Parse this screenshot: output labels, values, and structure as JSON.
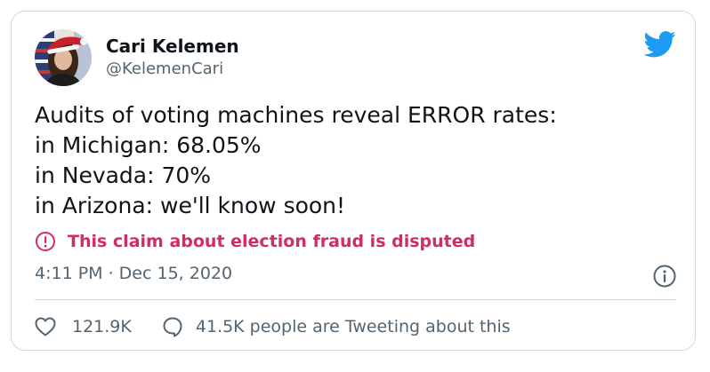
{
  "tweet": {
    "author_name": "Cari Kelemen",
    "author_handle": "@KelemenCari",
    "text_lines": [
      "Audits of voting machines reveal ERROR rates:",
      "in Michigan: 68.05%",
      "in Nevada: 70%",
      "in Arizona: we'll know soon!"
    ],
    "warning_label": "This claim about election fraud is disputed",
    "timestamp": "4:11 PM · Dec 15, 2020",
    "likes": "121.9K",
    "conversation": "41.5K people are Tweeting about this"
  },
  "colors": {
    "brand": "#1d9bf0",
    "warning": "#d02d65",
    "secondary_text": "#536471",
    "border": "#cfd9de"
  },
  "icons": {
    "logo": "twitter-bird-icon",
    "warning": "exclamation-circle-icon",
    "info": "info-icon",
    "like": "heart-icon",
    "reply": "speech-bubble-icon"
  }
}
